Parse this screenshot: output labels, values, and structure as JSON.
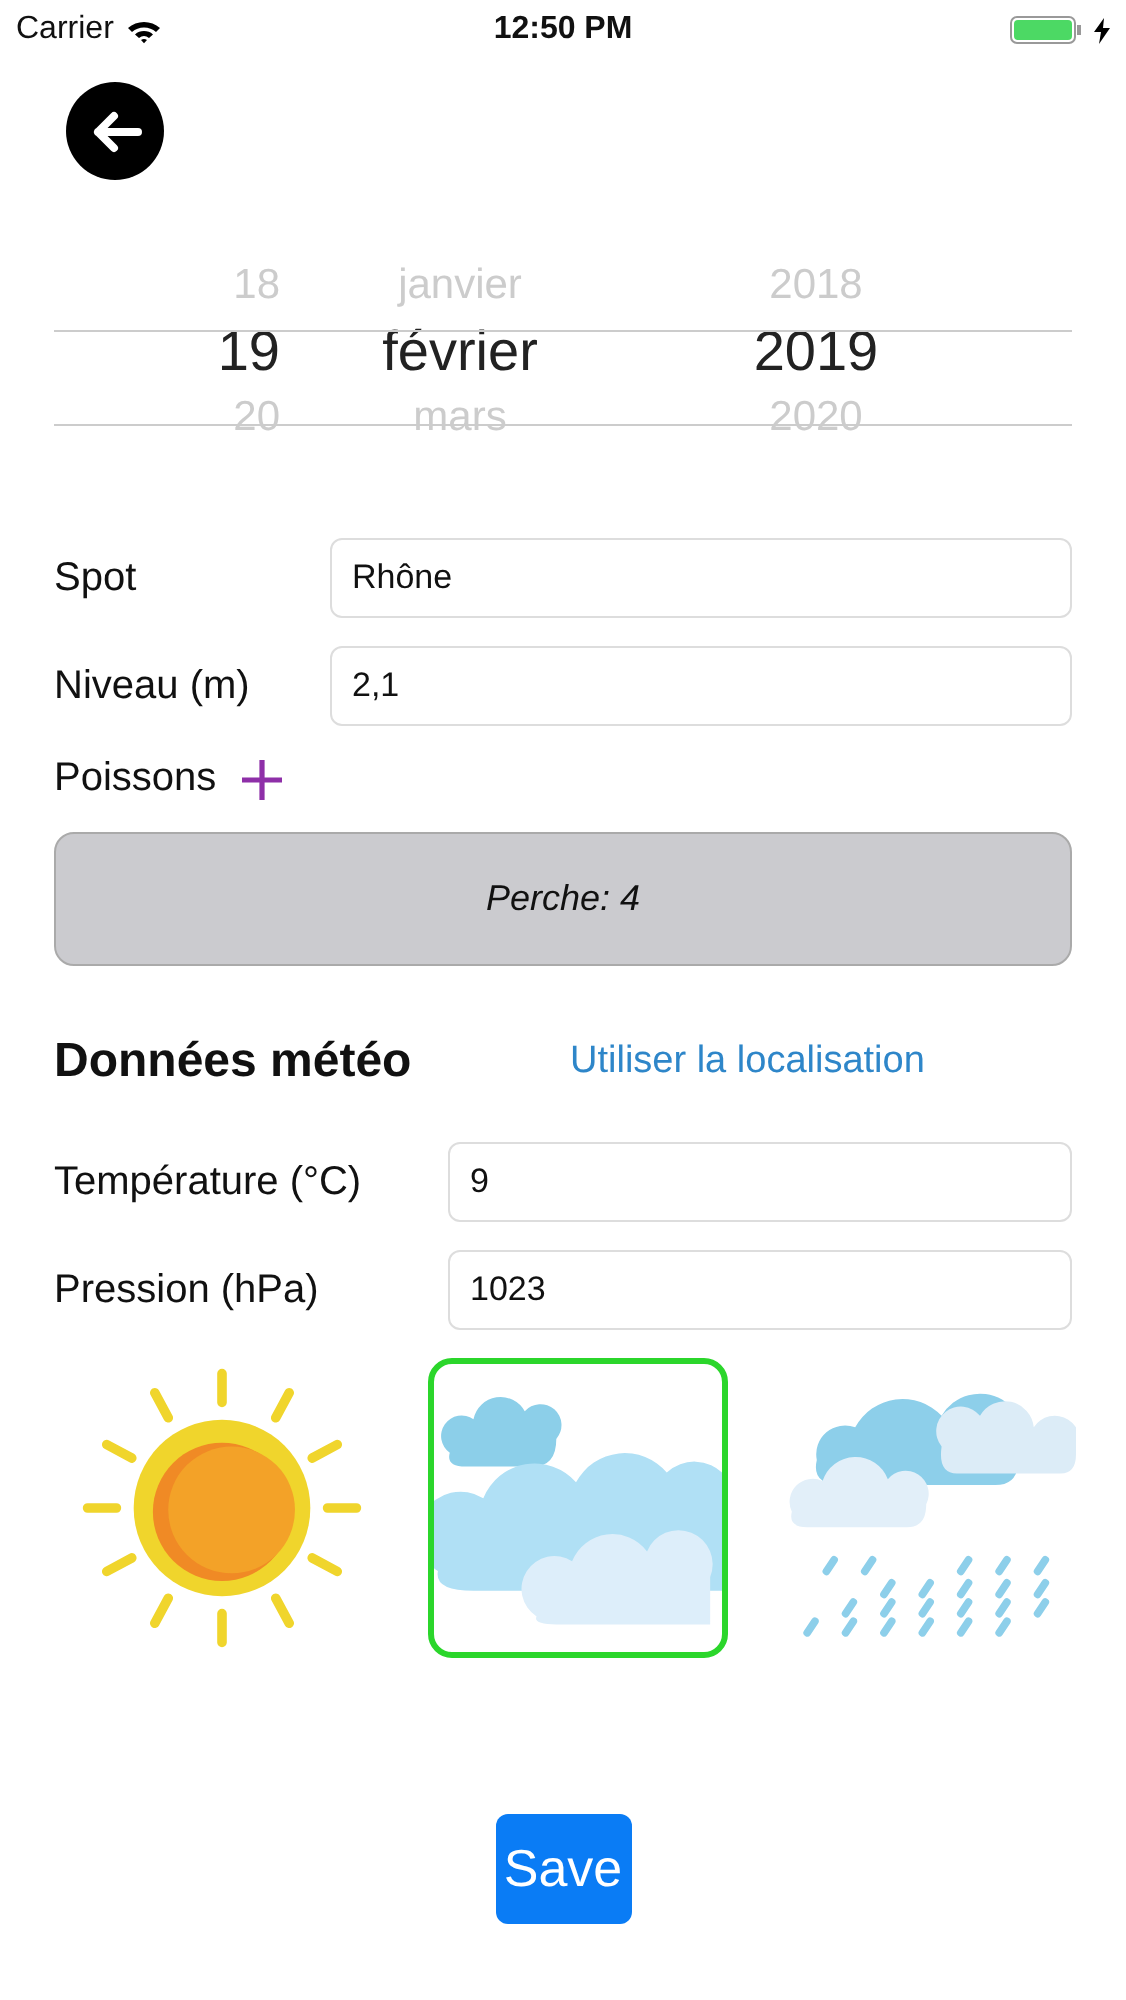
{
  "status_bar": {
    "carrier": "Carrier",
    "time": "12:50 PM"
  },
  "date_picker": {
    "columns": [
      {
        "items": [
          {
            "label": "18",
            "selected": false
          },
          {
            "label": "19",
            "selected": true
          },
          {
            "label": "20",
            "selected": false
          }
        ]
      },
      {
        "items": [
          {
            "label": "janvier",
            "selected": false
          },
          {
            "label": "février",
            "selected": true
          },
          {
            "label": "mars",
            "selected": false
          }
        ]
      },
      {
        "items": [
          {
            "label": "2018",
            "selected": false
          },
          {
            "label": "2019",
            "selected": true
          },
          {
            "label": "2020",
            "selected": false
          }
        ]
      }
    ]
  },
  "fields": [
    {
      "label": "Spot",
      "value": "Rhône"
    },
    {
      "label": "Niveau (m)",
      "value": "2,1"
    }
  ],
  "fish": {
    "label": "Poissons",
    "entries": [
      "Perche: 4"
    ]
  },
  "weather": {
    "title": "Données météo",
    "link": "Utiliser la localisation",
    "fields": [
      {
        "label": "Température (°C)",
        "value": "9"
      },
      {
        "label": "Pression (hPa)",
        "value": "1023"
      }
    ],
    "conditions": [
      {
        "kind": "sunny",
        "selected": false
      },
      {
        "kind": "cloudy",
        "selected": true
      },
      {
        "kind": "rainy",
        "selected": false
      }
    ]
  },
  "save_button": "Save"
}
